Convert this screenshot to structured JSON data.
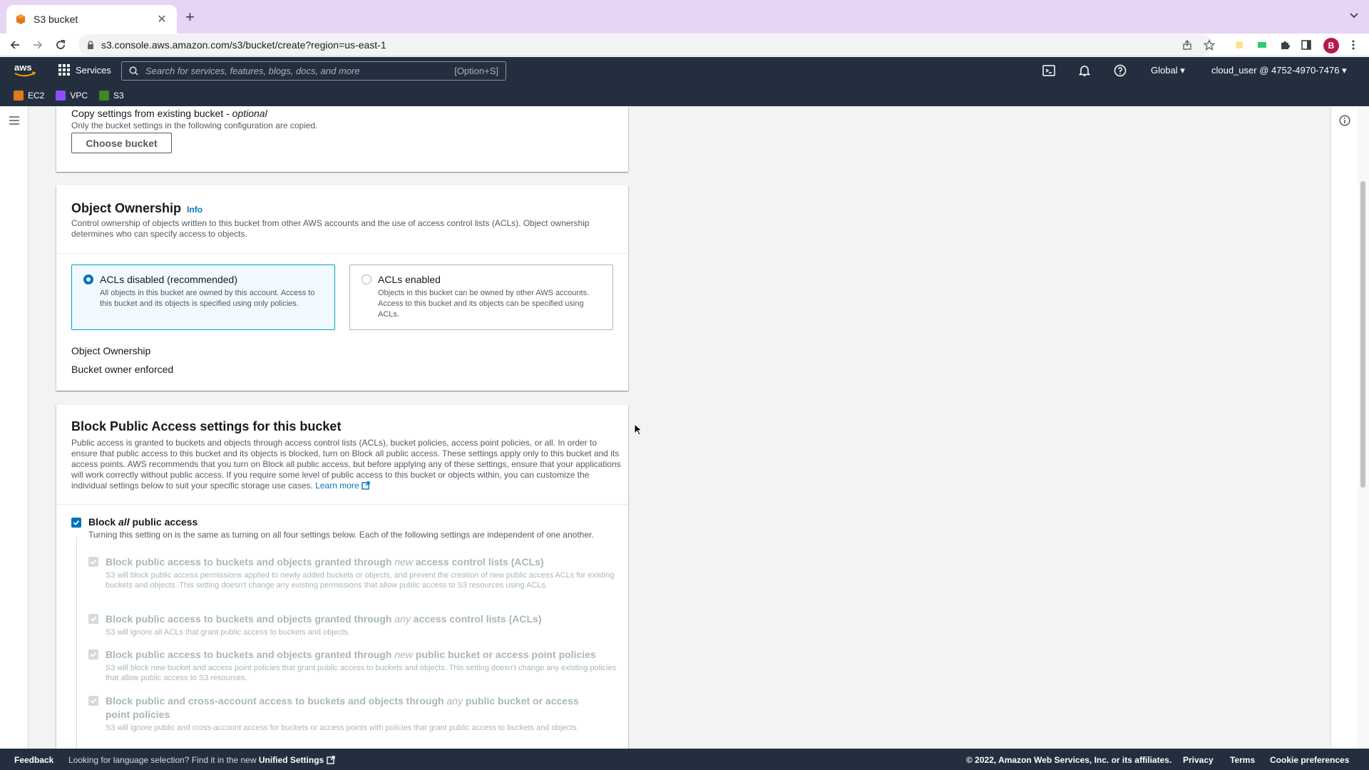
{
  "browser": {
    "tab_title": "S3 bucket",
    "url": "s3.console.aws.amazon.com/s3/bucket/create?region=us-east-1",
    "profile_initial": "B"
  },
  "aws_nav": {
    "services_label": "Services",
    "search_placeholder": "Search for services, features, blogs, docs, and more",
    "search_shortcut": "[Option+S]",
    "region": "Global",
    "account": "cloud_user @ 4752-4970-7476",
    "favorites": [
      {
        "label": "EC2",
        "color": "#e07b1a"
      },
      {
        "label": "VPC",
        "color": "#8c4fff"
      },
      {
        "label": "S3",
        "color": "#3f8624"
      }
    ]
  },
  "copy_settings": {
    "title": "Copy settings from existing bucket - ",
    "title_optional": "optional",
    "description": "Only the bucket settings in the following configuration are copied.",
    "button": "Choose bucket"
  },
  "object_ownership": {
    "heading": "Object Ownership",
    "info": "Info",
    "description": "Control ownership of objects written to this bucket from other AWS accounts and the use of access control lists (ACLs). Object ownership determines who can specify access to objects.",
    "options": [
      {
        "label": "ACLs disabled (recommended)",
        "description": "All objects in this bucket are owned by this account. Access to this bucket and its objects is specified using only policies.",
        "selected": true
      },
      {
        "label": "ACLs enabled",
        "description": "Objects in this bucket can be owned by other AWS accounts. Access to this bucket and its objects can be specified using ACLs.",
        "selected": false
      }
    ],
    "field_label": "Object Ownership",
    "field_value": "Bucket owner enforced"
  },
  "block_public_access": {
    "heading": "Block Public Access settings for this bucket",
    "description": "Public access is granted to buckets and objects through access control lists (ACLs), bucket policies, access point policies, or all. In order to ensure that public access to this bucket and its objects is blocked, turn on Block all public access. These settings apply only to this bucket and its access points. AWS recommends that you turn on Block all public access, but before applying any of these settings, ensure that your applications will work correctly without public access. If you require some level of public access to this bucket or objects within, you can customize the individual settings below to suit your specific storage use cases.",
    "learn_more": "Learn more",
    "block_all": {
      "label_pre": "Block ",
      "label_em": "all",
      "label_post": " public access",
      "description": "Turning this setting on is the same as turning on all four settings below. Each of the following settings are independent of one another.",
      "checked": true
    },
    "settings": [
      {
        "pre": "Block public access to buckets and objects granted through ",
        "em": "new",
        "post": " access control lists (ACLs)",
        "description": "S3 will block public access permissions applied to newly added buckets or objects, and prevent the creation of new public access ACLs for existing buckets and objects. This setting doesn't change any existing permissions that allow public access to S3 resources using ACLs."
      },
      {
        "pre": "Block public access to buckets and objects granted through ",
        "em": "any",
        "post": " access control lists (ACLs)",
        "description": "S3 will ignore all ACLs that grant public access to buckets and objects."
      },
      {
        "pre": "Block public access to buckets and objects granted through ",
        "em": "new",
        "post": " public bucket or access point policies",
        "description": "S3 will block new bucket and access point policies that grant public access to buckets and objects. This setting doesn't change any existing policies that allow public access to S3 resources."
      },
      {
        "pre": "Block public and cross-account access to buckets and objects through ",
        "em": "any",
        "post": " public bucket or access point policies",
        "description": "S3 will ignore public and cross-account access for buckets or access points with policies that grant public access to buckets and objects."
      }
    ]
  },
  "footer": {
    "feedback": "Feedback",
    "language_note": "Looking for language selection? Find it in the new",
    "unified_settings": "Unified Settings",
    "copyright": "© 2022, Amazon Web Services, Inc. or its affiliates.",
    "privacy": "Privacy",
    "terms": "Terms",
    "cookies": "Cookie preferences"
  }
}
